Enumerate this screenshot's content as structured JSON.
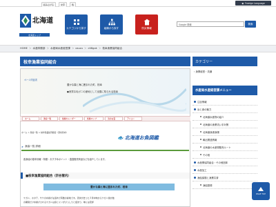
{
  "topbar": {
    "links": [
      "読み上げる",
      "文字",
      "色"
    ],
    "foreign_language": "Foreign Language"
  },
  "header": {
    "logo_text": "北海道",
    "logo_sub": "北海道トップ",
    "nav": [
      {
        "label": "カテゴリから探す",
        "icon": "category-icon"
      },
      {
        "label": "組織から探す",
        "icon": "organization-icon"
      },
      {
        "label": "防災情報",
        "icon": "disaster-icon"
      }
    ],
    "search_placeholder": "Google 検索",
    "search_button": "検索"
  },
  "breadcrumb": [
    "HOME",
    "水産林務部",
    "水産局水産経営課",
    "osuzu",
    "ctl6gok",
    "枝幸漁業協同組合"
  ],
  "main": {
    "title": "枝幸漁業協同組合",
    "page_id": "ページ内目次",
    "banner_lines": [
      "豊かな森と海に囲まれた町、枝幸",
      "●良質な毛ガニの産地として全国に知られる枝幸"
    ],
    "tabs": [
      "ホーム",
      "漁協一覧",
      "魚種カレンダー",
      "各種マップ",
      "浜のお宝",
      "アイコン"
    ],
    "sub_crumbs": [
      "ホーム",
      ">",
      "漁協一覧",
      ">",
      "枝幸漁業協同組合（宗谷管内）"
    ],
    "sub_logo": "北海道お魚図鑑",
    "section_label": "漁協一覧 詳細",
    "intro": "各漁協の基本情報・特徴・おすすめポイント・直直販売商品などを紹介しています。",
    "coop_head": "■枝幸漁業協同組合（宗谷管内）",
    "coop_sub": "豊かな森と海に囲まれた町、枝幸",
    "coop_text_1": "ケガニ、ホタテ、サケの水揚げは道内で有数の産地です。流氷が去った３月中旬からケガニ漁が始",
    "coop_text_2": "の期間だけ水揚げされるケガニは身とミソがびっしりと詰まり、味には定評"
  },
  "sidebar": {
    "category_heading": "カテゴリー",
    "category_item": "漁業経営・流通",
    "menu_heading": "水産局水産経営課メニュー",
    "items": [
      {
        "label": "注目情報",
        "sub": false
      },
      {
        "label": "浜と食の魅力",
        "sub": false
      },
      {
        "label": "北海道水産物の紹介",
        "sub": true
      },
      {
        "label": "北海道の漁業流い手対策",
        "sub": true
      },
      {
        "label": "北海道漁港漁場",
        "sub": true
      },
      {
        "label": "輸出関連情報",
        "sub": true
      },
      {
        "label": "北海道の水産物販売ルート",
        "sub": true
      },
      {
        "label": "その他",
        "sub": true
      },
      {
        "label": "水産業協同組合・その他団体",
        "sub": false
      },
      {
        "label": "水産加工",
        "sub": false
      },
      {
        "label": "漁船保険と漁業共済",
        "sub": false
      },
      {
        "label": "漁船登録",
        "sub": true
      }
    ]
  },
  "page_top": "PAGE TOP",
  "colors": {
    "primary": "#1e5aa8",
    "alert": "#c8211d",
    "accent_green": "#5a9a3a"
  }
}
